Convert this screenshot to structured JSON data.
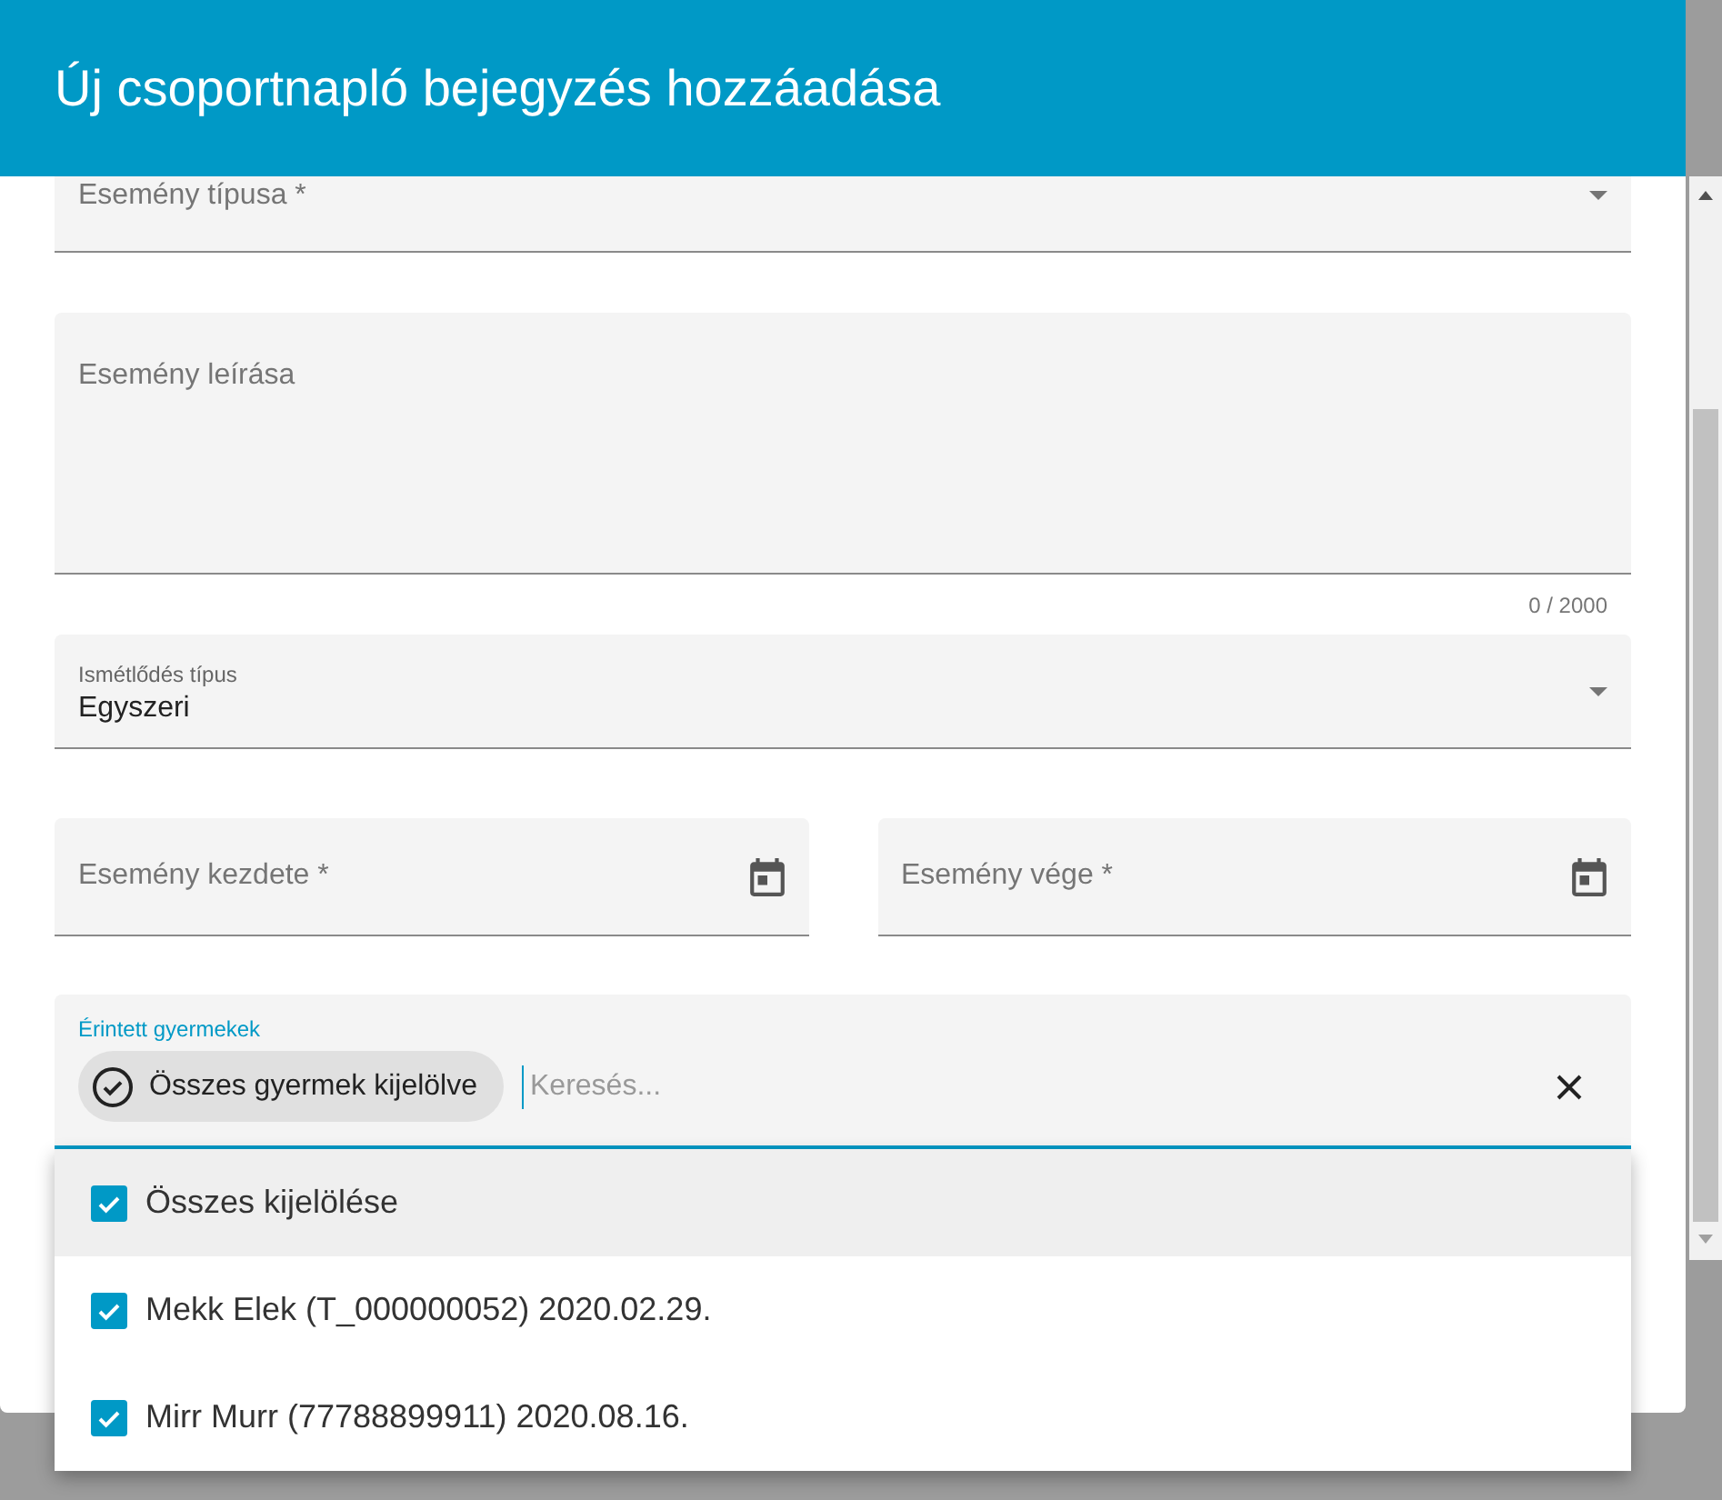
{
  "dialog": {
    "title": "Új csoportnapló bejegyzés hozzáadása"
  },
  "fields": [
    {
      "kind": "select",
      "label": "Esemény típusa *"
    },
    {
      "kind": "textarea",
      "label": "Esemény leírása",
      "counter": "0 / 2000"
    },
    {
      "kind": "select",
      "label": "Ismétlődés típus",
      "value": "Egyszeri"
    }
  ],
  "date_fields": [
    {
      "label": "Esemény kezdete *"
    },
    {
      "label": "Esemény vége *"
    }
  ],
  "children_field": {
    "label": "Érintett gyermekek",
    "chip": "Összes gyermek kijelölve",
    "placeholder": "Keresés...",
    "focused": true
  },
  "options": [
    {
      "label": "Összes kijelölése",
      "checked": true,
      "highlighted": true
    },
    {
      "label": "Mekk Elek (T_000000052) 2020.02.29.",
      "checked": true,
      "highlighted": false
    },
    {
      "label": "Mirr Murr (77788899911) 2020.08.16.",
      "checked": true,
      "highlighted": false
    }
  ]
}
